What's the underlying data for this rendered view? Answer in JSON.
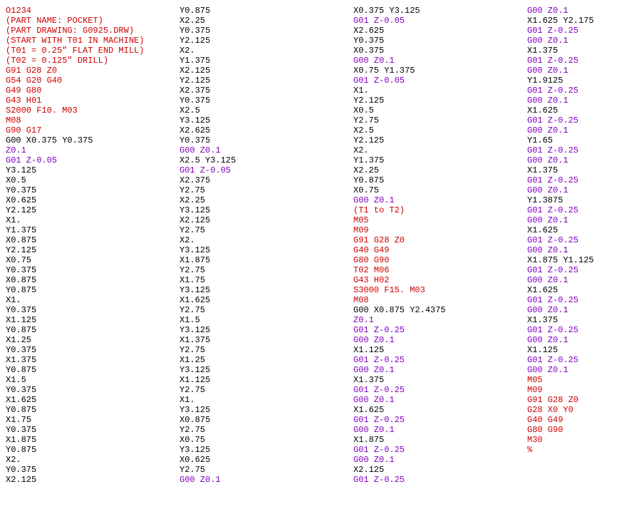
{
  "chart_data": {
    "type": "table",
    "title": "CNC G-code Program O1234 (POCKET)",
    "columns": [
      [
        {
          "t": "O1234",
          "c": "red"
        },
        {
          "t": "(PART NAME: POCKET)",
          "c": "red"
        },
        {
          "t": "(PART DRAWING: G0925.DRW)",
          "c": "red"
        },
        {
          "t": "(START WITH T01 IN MACHINE)",
          "c": "red"
        },
        {
          "t": "(T01 = 0.25\" FLAT END MILL)",
          "c": "red"
        },
        {
          "t": "(T02 = 0.125\" DRILL)",
          "c": "red"
        },
        {
          "t": "G91 G28 Z0",
          "c": "red"
        },
        {
          "t": "G54 G20 G40",
          "c": "red"
        },
        {
          "t": "G49 G80",
          "c": "red"
        },
        {
          "t": "G43 H01",
          "c": "red"
        },
        {
          "t": "S2000 F10. M03",
          "c": "red"
        },
        {
          "t": "M08",
          "c": "red"
        },
        {
          "t": "G90 G17",
          "c": "red"
        },
        {
          "t": "G00 X0.375 Y0.375",
          "c": "black"
        },
        {
          "t": "Z0.1",
          "c": "purple"
        },
        {
          "t": "G01 Z-0.05",
          "c": "purple"
        },
        {
          "t": "Y3.125",
          "c": "black"
        },
        {
          "t": "X0.5",
          "c": "black"
        },
        {
          "t": "Y0.375",
          "c": "black"
        },
        {
          "t": "X0.625",
          "c": "black"
        },
        {
          "t": "Y2.125",
          "c": "black"
        },
        {
          "t": "X1.",
          "c": "black"
        },
        {
          "t": "Y1.375",
          "c": "black"
        },
        {
          "t": "X0.875",
          "c": "black"
        },
        {
          "t": "Y2.125",
          "c": "black"
        },
        {
          "t": "X0.75",
          "c": "black"
        },
        {
          "t": "Y0.375",
          "c": "black"
        },
        {
          "t": "X0.875",
          "c": "black"
        },
        {
          "t": "Y0.875",
          "c": "black"
        },
        {
          "t": "X1.",
          "c": "black"
        },
        {
          "t": "Y0.375",
          "c": "black"
        },
        {
          "t": "X1.125",
          "c": "black"
        },
        {
          "t": "Y0.875",
          "c": "black"
        },
        {
          "t": "X1.25",
          "c": "black"
        },
        {
          "t": "Y0.375",
          "c": "black"
        },
        {
          "t": "X1.375",
          "c": "black"
        },
        {
          "t": "Y0.875",
          "c": "black"
        },
        {
          "t": "X1.5",
          "c": "black"
        },
        {
          "t": "Y0.375",
          "c": "black"
        },
        {
          "t": "X1.625",
          "c": "black"
        },
        {
          "t": "Y0.875",
          "c": "black"
        },
        {
          "t": "X1.75",
          "c": "black"
        },
        {
          "t": "Y0.375",
          "c": "black"
        },
        {
          "t": "X1.875",
          "c": "black"
        },
        {
          "t": "Y0.875",
          "c": "black"
        },
        {
          "t": "X2.",
          "c": "black"
        },
        {
          "t": "Y0.375",
          "c": "black"
        },
        {
          "t": "X2.125",
          "c": "black"
        }
      ],
      [
        {
          "t": "Y0.875",
          "c": "black"
        },
        {
          "t": "X2.25",
          "c": "black"
        },
        {
          "t": "Y0.375",
          "c": "black"
        },
        {
          "t": "Y2.125",
          "c": "black"
        },
        {
          "t": "X2.",
          "c": "black"
        },
        {
          "t": "Y1.375",
          "c": "black"
        },
        {
          "t": "X2.125",
          "c": "black"
        },
        {
          "t": "Y2.125",
          "c": "black"
        },
        {
          "t": "X2.375",
          "c": "black"
        },
        {
          "t": "Y0.375",
          "c": "black"
        },
        {
          "t": "X2.5",
          "c": "black"
        },
        {
          "t": "Y3.125",
          "c": "black"
        },
        {
          "t": "X2.625",
          "c": "black"
        },
        {
          "t": "Y0.375",
          "c": "black"
        },
        {
          "t": "G00 Z0.1",
          "c": "purple"
        },
        {
          "t": "X2.5 Y3.125",
          "c": "black"
        },
        {
          "t": "G01 Z-0.05",
          "c": "purple"
        },
        {
          "t": "X2.375",
          "c": "black"
        },
        {
          "t": "Y2.75",
          "c": "black"
        },
        {
          "t": "X2.25",
          "c": "black"
        },
        {
          "t": "Y3.125",
          "c": "black"
        },
        {
          "t": "X2.125",
          "c": "black"
        },
        {
          "t": "Y2.75",
          "c": "black"
        },
        {
          "t": "X2.",
          "c": "black"
        },
        {
          "t": "Y3.125",
          "c": "black"
        },
        {
          "t": "X1.875",
          "c": "black"
        },
        {
          "t": "Y2.75",
          "c": "black"
        },
        {
          "t": "X1.75",
          "c": "black"
        },
        {
          "t": "Y3.125",
          "c": "black"
        },
        {
          "t": "X1.625",
          "c": "black"
        },
        {
          "t": "Y2.75",
          "c": "black"
        },
        {
          "t": "X1.5",
          "c": "black"
        },
        {
          "t": "Y3.125",
          "c": "black"
        },
        {
          "t": "X1.375",
          "c": "black"
        },
        {
          "t": "Y2.75",
          "c": "black"
        },
        {
          "t": "X1.25",
          "c": "black"
        },
        {
          "t": "Y3.125",
          "c": "black"
        },
        {
          "t": "X1.125",
          "c": "black"
        },
        {
          "t": "Y2.75",
          "c": "black"
        },
        {
          "t": "X1.",
          "c": "black"
        },
        {
          "t": "Y3.125",
          "c": "black"
        },
        {
          "t": "X0.875",
          "c": "black"
        },
        {
          "t": "Y2.75",
          "c": "black"
        },
        {
          "t": "X0.75",
          "c": "black"
        },
        {
          "t": "Y3.125",
          "c": "black"
        },
        {
          "t": "X0.625",
          "c": "black"
        },
        {
          "t": "Y2.75",
          "c": "black"
        },
        {
          "t": "G00 Z0.1",
          "c": "purple"
        }
      ],
      [
        {
          "t": "X0.375 Y3.125",
          "c": "black"
        },
        {
          "t": "G01 Z-0.05",
          "c": "purple"
        },
        {
          "t": "X2.625",
          "c": "black"
        },
        {
          "t": "Y0.375",
          "c": "black"
        },
        {
          "t": "X0.375",
          "c": "black"
        },
        {
          "t": "G00 Z0.1",
          "c": "purple"
        },
        {
          "t": "X0.75 Y1.375",
          "c": "black"
        },
        {
          "t": "G01 Z-0.05",
          "c": "purple"
        },
        {
          "t": "X1.",
          "c": "black"
        },
        {
          "t": "Y2.125",
          "c": "black"
        },
        {
          "t": "X0.5",
          "c": "black"
        },
        {
          "t": "Y2.75",
          "c": "black"
        },
        {
          "t": "X2.5",
          "c": "black"
        },
        {
          "t": "Y2.125",
          "c": "black"
        },
        {
          "t": "X2.",
          "c": "black"
        },
        {
          "t": "Y1.375",
          "c": "black"
        },
        {
          "t": "X2.25",
          "c": "black"
        },
        {
          "t": "Y0.875",
          "c": "black"
        },
        {
          "t": "X0.75",
          "c": "black"
        },
        {
          "t": "G00 Z0.1",
          "c": "purple"
        },
        {
          "t": "(T1 to T2)",
          "c": "red"
        },
        {
          "t": "M05",
          "c": "red"
        },
        {
          "t": "M09",
          "c": "red"
        },
        {
          "t": "G91 G28 Z0",
          "c": "red"
        },
        {
          "t": "G40 G49",
          "c": "red"
        },
        {
          "t": "G80 G90",
          "c": "red"
        },
        {
          "t": "T02 M06",
          "c": "red"
        },
        {
          "t": "G43 H02",
          "c": "red"
        },
        {
          "t": "S3000 F15. M03",
          "c": "red"
        },
        {
          "t": "M08",
          "c": "red"
        },
        {
          "t": "G00 X0.875 Y2.4375",
          "c": "black"
        },
        {
          "t": "Z0.1",
          "c": "purple"
        },
        {
          "t": "G01 Z-0.25",
          "c": "purple"
        },
        {
          "t": "G00 Z0.1",
          "c": "purple"
        },
        {
          "t": "X1.125",
          "c": "black"
        },
        {
          "t": "G01 Z-0.25",
          "c": "purple"
        },
        {
          "t": "G00 Z0.1",
          "c": "purple"
        },
        {
          "t": "X1.375",
          "c": "black"
        },
        {
          "t": "G01 Z-0.25",
          "c": "purple"
        },
        {
          "t": "G00 Z0.1",
          "c": "purple"
        },
        {
          "t": "X1.625",
          "c": "black"
        },
        {
          "t": "G01 Z-0.25",
          "c": "purple"
        },
        {
          "t": "G00 Z0.1",
          "c": "purple"
        },
        {
          "t": "X1.875",
          "c": "black"
        },
        {
          "t": "G01 Z-0.25",
          "c": "purple"
        },
        {
          "t": "G00 Z0.1",
          "c": "purple"
        },
        {
          "t": "X2.125",
          "c": "black"
        },
        {
          "t": "G01 Z-0.25",
          "c": "purple"
        }
      ],
      [
        {
          "t": "G00 Z0.1",
          "c": "purple"
        },
        {
          "t": "X1.625 Y2.175",
          "c": "black"
        },
        {
          "t": "G01 Z-0.25",
          "c": "purple"
        },
        {
          "t": "G00 Z0.1",
          "c": "purple"
        },
        {
          "t": "X1.375",
          "c": "black"
        },
        {
          "t": "G01 Z-0.25",
          "c": "purple"
        },
        {
          "t": "G00 Z0.1",
          "c": "purple"
        },
        {
          "t": "Y1.9125",
          "c": "black"
        },
        {
          "t": "G01 Z-0.25",
          "c": "purple"
        },
        {
          "t": "G00 Z0.1",
          "c": "purple"
        },
        {
          "t": "X1.625",
          "c": "black"
        },
        {
          "t": "G01 Z-0.25",
          "c": "purple"
        },
        {
          "t": "G00 Z0.1",
          "c": "purple"
        },
        {
          "t": "Y1.65",
          "c": "black"
        },
        {
          "t": "G01 Z-0.25",
          "c": "purple"
        },
        {
          "t": "G00 Z0.1",
          "c": "purple"
        },
        {
          "t": "X1.375",
          "c": "black"
        },
        {
          "t": "G01 Z-0.25",
          "c": "purple"
        },
        {
          "t": "G00 Z0.1",
          "c": "purple"
        },
        {
          "t": "Y1.3875",
          "c": "black"
        },
        {
          "t": "G01 Z-0.25",
          "c": "purple"
        },
        {
          "t": "G00 Z0.1",
          "c": "purple"
        },
        {
          "t": "X1.625",
          "c": "black"
        },
        {
          "t": "G01 Z-0.25",
          "c": "purple"
        },
        {
          "t": "G00 Z0.1",
          "c": "purple"
        },
        {
          "t": "X1.875 Y1.125",
          "c": "black"
        },
        {
          "t": "G01 Z-0.25",
          "c": "purple"
        },
        {
          "t": "G00 Z0.1",
          "c": "purple"
        },
        {
          "t": "X1.625",
          "c": "black"
        },
        {
          "t": "G01 Z-0.25",
          "c": "purple"
        },
        {
          "t": "G00 Z0.1",
          "c": "purple"
        },
        {
          "t": "X1.375",
          "c": "black"
        },
        {
          "t": "G01 Z-0.25",
          "c": "purple"
        },
        {
          "t": "G00 Z0.1",
          "c": "purple"
        },
        {
          "t": "X1.125",
          "c": "black"
        },
        {
          "t": "G01 Z-0.25",
          "c": "purple"
        },
        {
          "t": "G00 Z0.1",
          "c": "purple"
        },
        {
          "t": "M05",
          "c": "red"
        },
        {
          "t": "M09",
          "c": "red"
        },
        {
          "t": "G91 G28 Z0",
          "c": "red"
        },
        {
          "t": "G28 X0 Y0",
          "c": "red"
        },
        {
          "t": "G40 G49",
          "c": "red"
        },
        {
          "t": "G80 G90",
          "c": "red"
        },
        {
          "t": "M30",
          "c": "red"
        },
        {
          "t": "%",
          "c": "red"
        }
      ]
    ]
  }
}
